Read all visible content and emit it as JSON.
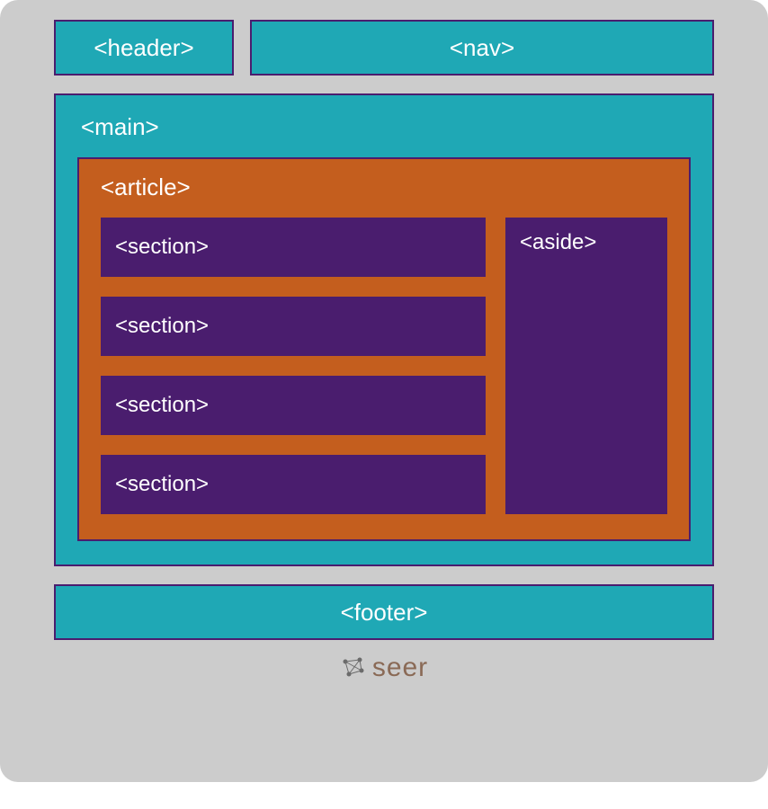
{
  "header": {
    "label": "<header>"
  },
  "nav": {
    "label": "<nav>"
  },
  "main": {
    "label": "<main>",
    "article": {
      "label": "<article>",
      "sections": [
        {
          "label": "<section>"
        },
        {
          "label": "<section>"
        },
        {
          "label": "<section>"
        },
        {
          "label": "<section>"
        }
      ],
      "aside": {
        "label": "<aside>"
      }
    }
  },
  "footer": {
    "label": "<footer>"
  },
  "brand": {
    "name": "seer"
  }
}
